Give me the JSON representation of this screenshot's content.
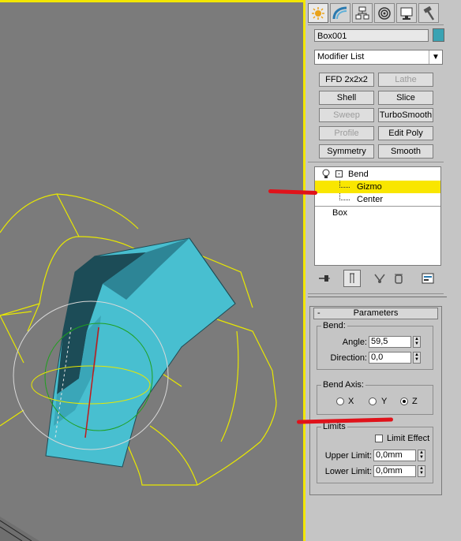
{
  "tabs": [
    {
      "name": "create-tab",
      "icon": "sun-icon",
      "active": true
    },
    {
      "name": "modify-tab",
      "icon": "rainbow-curve-icon"
    },
    {
      "name": "hierarchy-tab",
      "icon": "hierarchy-icon"
    },
    {
      "name": "motion-tab",
      "icon": "motion-icon"
    },
    {
      "name": "display-tab",
      "icon": "display-monitor-icon"
    },
    {
      "name": "utilities-tab",
      "icon": "hammer-icon"
    }
  ],
  "object": {
    "name": "Box001",
    "color": "#3aa3b3"
  },
  "modifier_list": {
    "label": "Modifier List"
  },
  "modifier_buttons": [
    {
      "label": "FFD 2x2x2",
      "enabled": true
    },
    {
      "label": "Lathe",
      "enabled": false
    },
    {
      "label": "Shell",
      "enabled": true
    },
    {
      "label": "Slice",
      "enabled": true
    },
    {
      "label": "Sweep",
      "enabled": false
    },
    {
      "label": "TurboSmooth",
      "enabled": true
    },
    {
      "label": "Profile",
      "enabled": false
    },
    {
      "label": "Edit Poly",
      "enabled": true
    },
    {
      "label": "Symmetry",
      "enabled": true
    },
    {
      "label": "Smooth",
      "enabled": true
    }
  ],
  "stack": {
    "modifier": "Bend",
    "subobjects": [
      "Gizmo",
      "Center"
    ],
    "selected_subobject": "Gizmo",
    "base_object": "Box"
  },
  "parameters": {
    "title": "Parameters",
    "collapse": "-",
    "bend_group": "Bend:",
    "angle_label": "Angle:",
    "angle_value": "59,5",
    "direction_label": "Direction:",
    "direction_value": "0,0",
    "axis_group": "Bend Axis:",
    "axes": [
      "X",
      "Y",
      "Z"
    ],
    "selected_axis": "Z",
    "limits_group": "Limits",
    "limit_effect_label": "Limit Effect",
    "limit_effect_checked": false,
    "upper_limit_label": "Upper Limit:",
    "upper_limit_value": "0,0mm",
    "lower_limit_label": "Lower Limit:",
    "lower_limit_value": "0,0mm"
  },
  "colors": {
    "selection_yellow": "#f9e600",
    "viewport_border": "#f2e600",
    "annotation_red": "#e0121a",
    "mesh_cyan": "#48bfd0",
    "gizmo_yellow": "#e8e800"
  }
}
